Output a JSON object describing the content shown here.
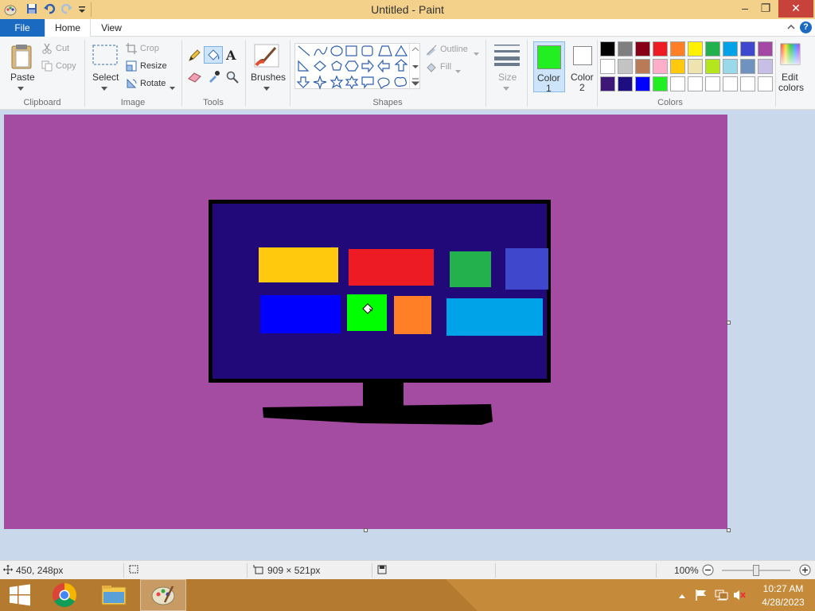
{
  "window": {
    "title": "Untitled - Paint",
    "minimize_glyph": "–",
    "restore_glyph": "❐",
    "close_glyph": "✕"
  },
  "menu": {
    "file": "File",
    "home": "Home",
    "view": "View",
    "help": "?"
  },
  "ribbon": {
    "clipboard": {
      "label": "Clipboard",
      "paste": "Paste",
      "cut": "Cut",
      "copy": "Copy"
    },
    "image": {
      "label": "Image",
      "select": "Select",
      "crop": "Crop",
      "resize": "Resize",
      "rotate": "Rotate"
    },
    "tools": {
      "label": "Tools",
      "text_glyph": "A"
    },
    "brushes": {
      "label": "Brushes"
    },
    "shapes": {
      "label": "Shapes",
      "outline": "Outline",
      "fill": "Fill"
    },
    "size": {
      "label": "Size"
    },
    "colors": {
      "label": "Colors",
      "color1": "Color",
      "color1_num": "1",
      "color2": "Color",
      "color2_num": "2",
      "edit_colors": "Edit",
      "edit_colors_2": "colors",
      "color1_value": "#22ee22",
      "color2_value": "#ffffff",
      "palette": [
        "#000000",
        "#7f7f7f",
        "#880015",
        "#ed1c24",
        "#ff7f27",
        "#fff200",
        "#22b14c",
        "#00a2e8",
        "#3f48cc",
        "#a349a4",
        "#ffffff",
        "#c3c3c3",
        "#b97a57",
        "#ffaec9",
        "#ffc90e",
        "#efe4b0",
        "#b5e61d",
        "#99d9ea",
        "#7092be",
        "#c8bfe7",
        "#3c1778",
        "#1c0e80",
        "#0000ff",
        "#22ee22",
        "#ffffff",
        "#ffffff",
        "#ffffff",
        "#ffffff",
        "#ffffff",
        "#ffffff"
      ]
    }
  },
  "canvas": {
    "background": "#a44ca1",
    "monitor_bezel": "#000000",
    "monitor_screen": "#21097a",
    "tile_colors": [
      "#ffc90e",
      "#ed1c24",
      "#22b14c",
      "#3f48cc",
      "#0000ff",
      "#00ff00",
      "#ff7f27",
      "#00a2e8"
    ]
  },
  "status": {
    "cursor_pos": "450, 248px",
    "image_size": "909 × 521px",
    "zoom": "100%"
  },
  "taskbar": {
    "time": "10:27 AM",
    "date": "4/28/2023"
  }
}
